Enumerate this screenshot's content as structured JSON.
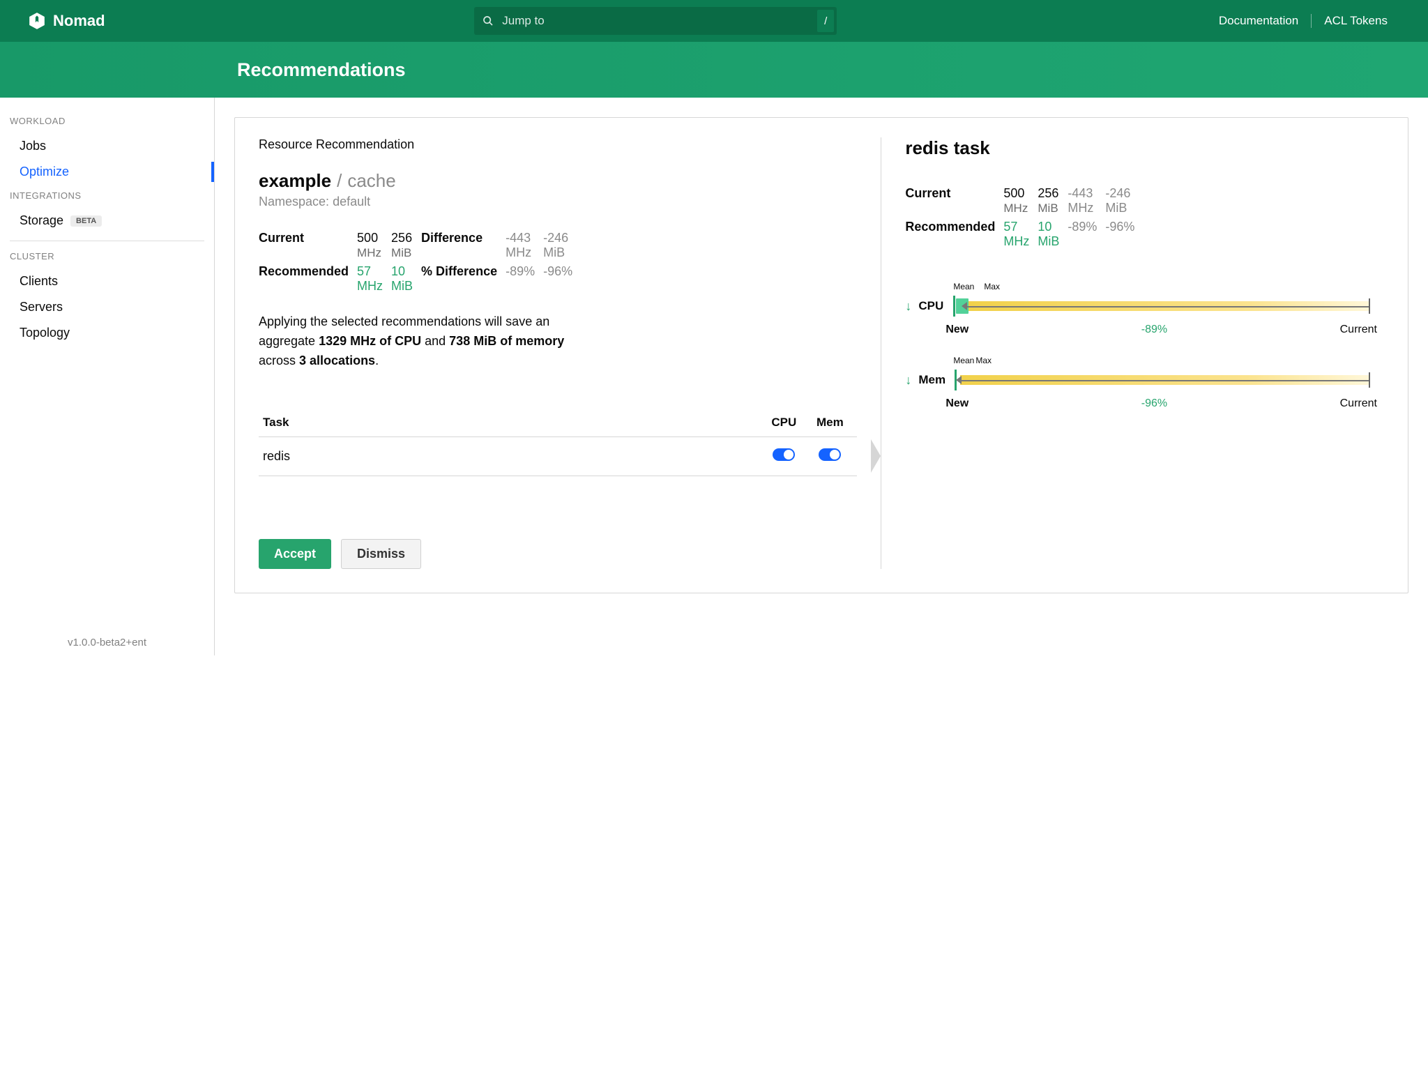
{
  "app_name": "Nomad",
  "search": {
    "placeholder": "Jump to",
    "slash": "/"
  },
  "top_links": [
    "Documentation",
    "ACL Tokens"
  ],
  "page_title": "Recommendations",
  "sidebar": {
    "sections": [
      {
        "label": "WORKLOAD",
        "items": [
          {
            "label": "Jobs",
            "active": false
          },
          {
            "label": "Optimize",
            "active": true
          }
        ]
      },
      {
        "label": "INTEGRATIONS",
        "items": [
          {
            "label": "Storage",
            "badge": "BETA"
          }
        ]
      },
      {
        "label": "CLUSTER",
        "items": [
          {
            "label": "Clients"
          },
          {
            "label": "Servers"
          },
          {
            "label": "Topology"
          }
        ]
      }
    ]
  },
  "version": "v1.0.0-beta2+ent",
  "rec": {
    "section_label": "Resource Recommendation",
    "job": "example",
    "group": "cache",
    "ns_label": "Namespace:",
    "ns": "default",
    "labels": {
      "current": "Current",
      "recommended": "Recommended",
      "difference": "Difference",
      "pct_difference": "% Difference"
    },
    "current": {
      "cpu": "500",
      "cpu_unit": "MHz",
      "mem": "256",
      "mem_unit": "MiB"
    },
    "recommended": {
      "cpu": "57",
      "cpu_unit": "MHz",
      "mem": "10",
      "mem_unit": "MiB"
    },
    "diff": {
      "cpu": "-443",
      "cpu_unit": "MHz",
      "mem": "-246",
      "mem_unit": "MiB"
    },
    "pct": {
      "cpu": "-89%",
      "mem": "-96%"
    },
    "explain": {
      "prefix": "Applying the selected recommendations will save an aggregate ",
      "cpu": "1329 MHz of CPU",
      "mid": " and ",
      "mem": "738 MiB of memory",
      "mid2": " across ",
      "allocs": "3 allocations",
      "suffix": "."
    },
    "table": {
      "headers": {
        "task": "Task",
        "cpu": "CPU",
        "mem": "Mem"
      },
      "rows": [
        {
          "name": "redis",
          "cpu": true,
          "mem": true
        }
      ]
    },
    "buttons": {
      "accept": "Accept",
      "dismiss": "Dismiss"
    }
  },
  "task_pane": {
    "title": "redis task",
    "current": {
      "cpu": "500",
      "cpu_unit": "MHz",
      "mem": "256",
      "mem_unit": "MiB"
    },
    "recommended": {
      "cpu": "57",
      "cpu_unit": "MHz",
      "mem": "10",
      "mem_unit": "MiB"
    },
    "diff": {
      "cpu": "-443",
      "cpu_unit": "MHz",
      "mem": "-246",
      "mem_unit": "MiB"
    },
    "pct": {
      "cpu": "-89%",
      "mem": "-96%"
    },
    "charts": {
      "mean": "Mean",
      "max": "Max",
      "new": "New",
      "current": "Current",
      "cpu_label": "CPU",
      "cpu_pct": "-89%",
      "mem_label": "Mem",
      "mem_pct": "-96%"
    }
  },
  "chart_data": [
    {
      "type": "bar",
      "title": "CPU",
      "series": [
        {
          "name": "Current",
          "values": [
            500
          ]
        },
        {
          "name": "New",
          "values": [
            57
          ]
        }
      ],
      "delta_pct": -89,
      "markers": {
        "mean": 40,
        "max": 60
      },
      "unit": "MHz"
    },
    {
      "type": "bar",
      "title": "Mem",
      "series": [
        {
          "name": "Current",
          "values": [
            256
          ]
        },
        {
          "name": "New",
          "values": [
            10
          ]
        }
      ],
      "delta_pct": -96,
      "markers": {
        "mean": 8,
        "max": 12
      },
      "unit": "MiB"
    }
  ]
}
